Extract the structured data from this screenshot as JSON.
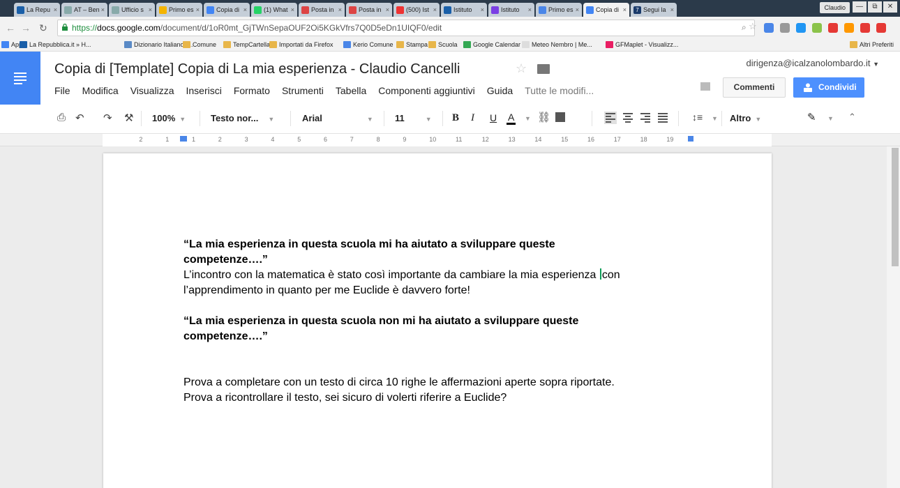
{
  "browser": {
    "tabs": [
      {
        "label": "La Repu",
        "color": "#1a5fa8"
      },
      {
        "label": "AT – Ben",
        "color": "#8aa"
      },
      {
        "label": "Ufficio s",
        "color": "#8aa"
      },
      {
        "label": "Primo es",
        "color": "#f4b400"
      },
      {
        "label": "Copia di",
        "color": "#4285f4"
      },
      {
        "label": "(1) What",
        "color": "#25d366"
      },
      {
        "label": "Posta in",
        "color": "#d44"
      },
      {
        "label": "Posta in",
        "color": "#d44"
      },
      {
        "label": "(500) Ist",
        "color": "#e33"
      },
      {
        "label": "Istituto",
        "color": "#1a5fa8"
      },
      {
        "label": "Istituto",
        "color": "#7b3fe4"
      },
      {
        "label": "Primo es",
        "color": "#4a86e8"
      },
      {
        "label": "Copia di",
        "color": "#4285f4"
      },
      {
        "label": "Segui la",
        "color": "#1a3a6a"
      }
    ],
    "tab_favicon_glyphs": [
      "",
      "",
      "",
      "",
      "",
      "",
      "",
      "",
      "",
      "",
      "",
      "",
      "",
      "7"
    ],
    "profile": "Claudio",
    "window_controls": [
      "—",
      "⧉",
      "✕"
    ],
    "url_scheme": "https://",
    "url_host": "docs.google.com",
    "url_path": "/document/d/1oR0mt_GjTWnSepaOUF2Oi5KGkVfrs7Q0D5eDn1UIQF0/edit",
    "extension_colors": [
      "#4a86e8",
      "#999",
      "#2196f3",
      "#8bc34a",
      "#e53935",
      "#ff9800",
      "#e53935",
      "#e53935"
    ],
    "bookmarks": [
      {
        "label": "App",
        "color": "#4285f4"
      },
      {
        "label": "La Repubblica.it » H...",
        "color": "#1a5fa8"
      },
      {
        "label": "Dizionario Italiano-I...",
        "color": "#5a8ac6"
      },
      {
        "label": "Comune",
        "color": "#e8b64a"
      },
      {
        "label": "TempCartella",
        "color": "#e8b64a"
      },
      {
        "label": "Importati da Firefox",
        "color": "#e8b64a"
      },
      {
        "label": "Kerio Comune",
        "color": "#4a86e8"
      },
      {
        "label": "Stampa",
        "color": "#e8b64a"
      },
      {
        "label": "Scuola",
        "color": "#e8b64a"
      },
      {
        "label": "Google Calendar",
        "color": "#34a853"
      },
      {
        "label": "Meteo Nembro | Me...",
        "color": "#ddd"
      },
      {
        "label": "GFMaplet - Visualizz...",
        "color": "#e91e63"
      },
      {
        "label": "Altri Preferiti",
        "color": "#e8b64a"
      }
    ]
  },
  "docs": {
    "title": "Copia di [Template] Copia di La mia esperienza - Claudio Cancelli",
    "account": "dirigenza@icalzanolombardo.it",
    "menu": [
      "File",
      "Modifica",
      "Visualizza",
      "Inserisci",
      "Formato",
      "Strumenti",
      "Tabella",
      "Componenti aggiuntivi",
      "Guida"
    ],
    "saved_status": "Tutte le modifi...",
    "comments_label": "Commenti",
    "share_label": "Condividi",
    "brand_color": "#4285f4",
    "share_color": "#4d90fe"
  },
  "toolbar": {
    "zoom": "100%",
    "style": "Testo nor...",
    "font": "Arial",
    "size": "11",
    "bold": "B",
    "italic": "I",
    "underline": "U",
    "text_color": "A",
    "more": "Altro",
    "icons": [
      "print-icon",
      "undo-icon",
      "redo-icon",
      "paint-format-icon",
      "link-icon",
      "comment-icon",
      "align-left-icon",
      "align-center-icon",
      "align-right-icon",
      "justify-icon",
      "line-spacing-icon",
      "pencil-icon",
      "collapse-icon"
    ]
  },
  "ruler": {
    "labels": [
      "2",
      "1",
      "1",
      "2",
      "3",
      "4",
      "5",
      "6",
      "7",
      "8",
      "9",
      "10",
      "11",
      "12",
      "13",
      "14",
      "15",
      "16",
      "17",
      "18",
      "19"
    ]
  },
  "document": {
    "q1_line1": "“La mia esperienza in questa scuola mi ha aiutato a sviluppare queste",
    "q1_line2": "competenze….”",
    "a1_before_cursor": "L’incontro con la matematica è stato così importante da cambiare la mia esperienza ",
    "a1_after_cursor": "con",
    "a1_line2": "l’apprendimento in quanto per me Euclide è davvero forte!",
    "q2_line1": "“La mia esperienza in questa scuola non mi ha aiutato a sviluppare queste",
    "q2_line2": "competenze….”",
    "instruction1": "Prova a completare con un testo di circa 10 righe le affermazioni aperte sopra riportate.",
    "instruction2": "Prova a ricontrollare il testo, sei sicuro di volerti riferire a Euclide?",
    "cursor_color": "#0f9d58"
  }
}
